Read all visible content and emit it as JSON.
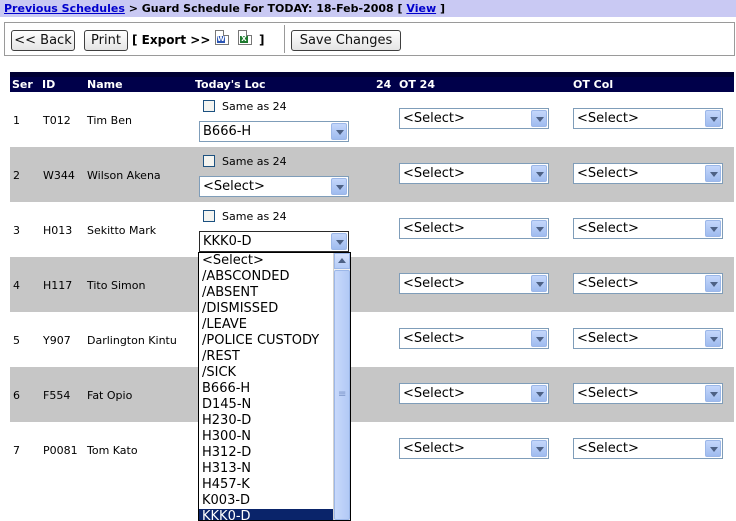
{
  "breadcrumb": {
    "previous_link": "Previous Schedules",
    "separator": " > ",
    "title": "Guard Schedule For TODAY: 18-Feb-2008 [ ",
    "view_link": "View",
    "closing": " ]"
  },
  "toolbar": {
    "back_label": "<< Back",
    "print_label": "Print",
    "export_label": "[ Export >>",
    "export_close": "]",
    "save_label": "Save Changes",
    "icons": [
      "word-document-icon",
      "excel-spreadsheet-icon"
    ]
  },
  "table": {
    "headers": {
      "ser": "Ser",
      "id": "ID",
      "name": "Name",
      "todays_loc": "Today's Loc",
      "col24": "24",
      "ot24": "OT 24",
      "otcol": "OT Col"
    },
    "rows": [
      {
        "ser": "1",
        "id": "T012",
        "name": "Tim Ben",
        "same_as_label": "Same as 24",
        "loc": "B666-H",
        "ot24": "<Select>",
        "otcol": "<Select>"
      },
      {
        "ser": "2",
        "id": "W344",
        "name": "Wilson Akena",
        "same_as_label": "Same as 24",
        "loc": "<Select>",
        "ot24": "<Select>",
        "otcol": "<Select>"
      },
      {
        "ser": "3",
        "id": "H013",
        "name": "Sekitto Mark",
        "same_as_label": "Same as 24",
        "loc": "KKK0-D",
        "ot24": "<Select>",
        "otcol": "<Select>"
      },
      {
        "ser": "4",
        "id": "H117",
        "name": "Tito Simon",
        "ot24": "<Select>",
        "otcol": "<Select>"
      },
      {
        "ser": "5",
        "id": "Y907",
        "name": "Darlington Kintu",
        "ot24": "<Select>",
        "otcol": "<Select>"
      },
      {
        "ser": "6",
        "id": "F554",
        "name": "Fat Opio",
        "ot24": "<Select>",
        "otcol": "<Select>"
      },
      {
        "ser": "7",
        "id": "P0081",
        "name": "Tom Kato",
        "ot24": "<Select>",
        "otcol": "<Select>"
      }
    ]
  },
  "dropdown": {
    "options": [
      "<Select>",
      "/ABSCONDED",
      "/ABSENT",
      "/DISMISSED",
      "/LEAVE",
      "/POLICE CUSTODY",
      "/REST",
      "/SICK",
      "B666-H",
      "D145-N",
      "H230-D",
      "H300-N",
      "H312-D",
      "H313-N",
      "H457-K",
      "K003-D",
      "KKK0-D"
    ],
    "highlighted": "KKK0-D"
  },
  "colors": {
    "header_bg": "#00004a",
    "breadcrumb_bg": "#c9c9f3",
    "row_alt_bg": "#c6c6c6",
    "link": "#0000cc",
    "highlight": "#0a246a"
  }
}
